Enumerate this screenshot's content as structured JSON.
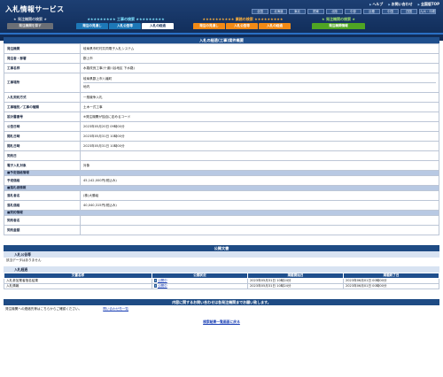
{
  "header": {
    "logo": "入札情報サービス",
    "top_links": [
      "ヘルプ",
      "お問い合わせ",
      "全国版TOP"
    ],
    "regions": [
      "全国",
      "北海道",
      "東北",
      "関東",
      "北陸",
      "中部",
      "近畿",
      "中国",
      "四国",
      "九州・沖縄",
      "",
      ""
    ],
    "categories": [
      {
        "title": "★ 発注機関の検索 ★",
        "style": "gray",
        "buttons": [
          "発注機関を探す"
        ]
      },
      {
        "title": "★★★★★★★★★ 工事の検索 ★★★★★★★★★",
        "style": "teal",
        "buttons": [
          "発注の見通し",
          "入札公告等",
          "入札の経過"
        ],
        "active": 2
      },
      {
        "title": "★★★★★★★★★★ 業務の検索 ★★★★★★★★★",
        "style": "orange",
        "buttons": [
          "発注の見通し",
          "入札公告等",
          "入札の経過"
        ]
      },
      {
        "title": "★ 発注機関の検索 ★",
        "style": "green",
        "buttons": [
          "発注機関情報"
        ]
      }
    ]
  },
  "detail": {
    "section_title": "入札の経過(工事)案件概要",
    "rows": [
      {
        "label": "発注機関",
        "value": "岐阜県市町村共同電子入札システム"
      },
      {
        "label": "発注者・部署",
        "value": "郡上市"
      },
      {
        "label": "工事名称",
        "value": "水路改良工事(十道川谷地区 下水路)"
      },
      {
        "label": "工事場所",
        "value": "岐阜県郡上市八幡町",
        "value2": "地内",
        "tall": true
      },
      {
        "label": "入札契約方式",
        "value": "一般競争入札"
      },
      {
        "label": "工事種別／工事の種類",
        "value": "土木一式工事"
      },
      {
        "label": "設計書番号",
        "value": "※発注機関が独自に定めるコード"
      },
      {
        "label": "公告日時",
        "value": "2023年05月20日 09時00分"
      },
      {
        "label": "開札日時",
        "value": "2023年05月31日 10時00分"
      },
      {
        "label": "開札日時",
        "value": "2023年05月31日 10時00分"
      },
      {
        "label": "契約日",
        "value": ""
      },
      {
        "label": "電子入札対象",
        "value": "対象"
      }
    ],
    "sub_price": "■予定価格情報",
    "price_rows": [
      {
        "label": "予定価格",
        "value": "45,142,000円(税込み)"
      }
    ],
    "sub_winner": "■落札者情報",
    "winner_rows": [
      {
        "label": "落札者名",
        "value": "(株)大勝組"
      },
      {
        "label": "落札価格",
        "value": "40,040,315円(税込み)"
      }
    ],
    "sub_contract": "■契約情報",
    "contract_rows": [
      {
        "label": "契約者名",
        "value": ""
      },
      {
        "label": "契約金額",
        "value": ""
      }
    ]
  },
  "docs": {
    "section_title": "公開文書",
    "tender_notice_head": "入札公告等",
    "tender_notice_text": "該当データはありません",
    "bid_history_head": "入札経過",
    "columns": [
      "文書名称",
      "公開状況",
      "掲載開始日",
      "掲載終了日"
    ],
    "rows": [
      {
        "name": "入札参加業者指名結果",
        "status": "公開中",
        "start": "2023年05月31日 10時24分",
        "end": "2023年06月01日 00時00分"
      },
      {
        "name": "入札情報",
        "status": "公開中",
        "start": "2023年05月31日 10時24分",
        "end": "2023年06月01日 00時00分"
      }
    ]
  },
  "contact": {
    "bar": "内容に関するお問い合わせは各発注機関までお願い致します。",
    "text": "発注機関への連絡先等はこちらからご確認ください。",
    "link": "問い合わせ先一覧"
  },
  "back_link": "検索結果一覧画面に戻る"
}
